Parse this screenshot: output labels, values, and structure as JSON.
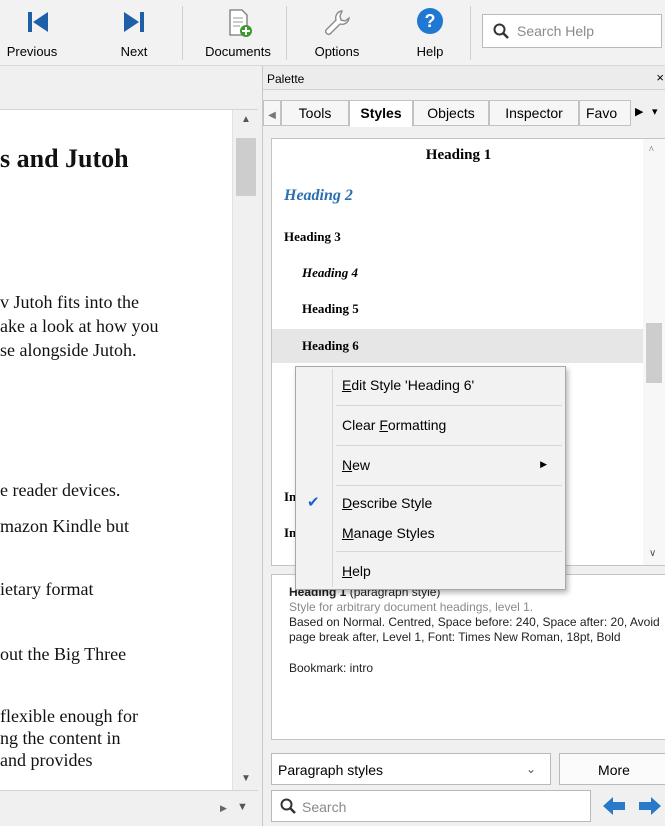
{
  "toolbar": {
    "previous_label": "Previous",
    "next_label": "Next",
    "documents_label": "Documents",
    "options_label": "Options",
    "help_label": "Help",
    "search_placeholder": "Search Help"
  },
  "document": {
    "heading_fragment": "s and Jutoh",
    "lines": [
      "v Jutoh fits into the",
      "ake a look at how you",
      "se alongside Jutoh.",
      "e reader devices.",
      "mazon Kindle but",
      "ietary format",
      "out the Big Three",
      "flexible enough for",
      "ng the content in",
      "and provides"
    ]
  },
  "palette": {
    "title": "Palette",
    "close": "×",
    "tabs": [
      "Tools",
      "Styles",
      "Objects",
      "Inspector",
      "Favo"
    ],
    "active_tab": "Styles",
    "styles": [
      "Heading 1",
      "Heading 2",
      "Heading 3",
      "Heading 4",
      "Heading 5",
      "Heading 6",
      "In",
      "In"
    ],
    "selected_style": "Heading 6",
    "description": {
      "name": "Heading 1",
      "kind": "(paragraph style)",
      "summary": "Style for arbitrary document headings, level 1.",
      "details": "Based on Normal. Centred, Space before: 240, Space after: 20, Avoid page break after, Level 1, Font: Times New Roman, 18pt, Bold",
      "bookmark": "Bookmark: intro"
    },
    "style_type_select": "Paragraph styles",
    "more_label": "More",
    "search_placeholder": "Search"
  },
  "context_menu": {
    "items": [
      {
        "pre": "",
        "ul": "E",
        "post": "dit Style 'Heading 6'"
      },
      {
        "pre": "Clear ",
        "ul": "F",
        "post": "ormatting"
      },
      {
        "pre": "",
        "ul": "N",
        "post": "ew"
      },
      {
        "pre": "",
        "ul": "D",
        "post": "escribe Style"
      },
      {
        "pre": "",
        "ul": "M",
        "post": "anage Styles"
      },
      {
        "pre": "",
        "ul": "H",
        "post": "elp"
      }
    ],
    "checked_item": "Describe Style"
  },
  "colors": {
    "heading2": "#2a6fb0",
    "accent_blue": "#1a66c8",
    "help_circle": "#1f78d1",
    "nav_icon": "#1f5fa8"
  }
}
